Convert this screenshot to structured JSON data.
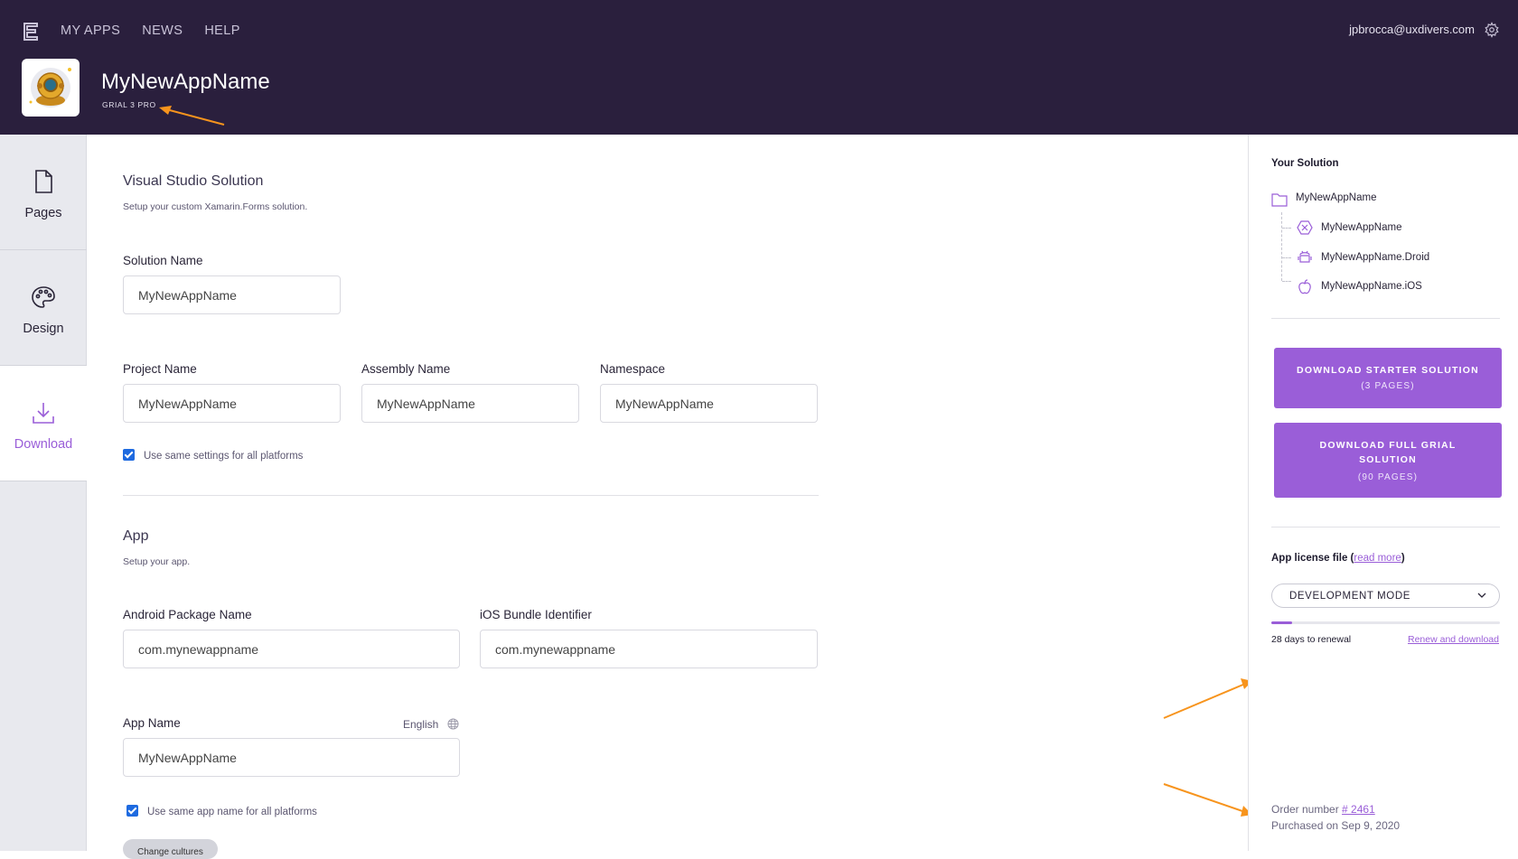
{
  "header": {
    "nav": [
      "MY APPS",
      "NEWS",
      "HELP"
    ],
    "user_email": "jpbrocca@uxdivers.com",
    "app_name": "MyNewAppName",
    "app_plan": "GRIAL 3 PRO"
  },
  "sidebar": {
    "items": [
      {
        "label": "Pages",
        "icon": "file-icon"
      },
      {
        "label": "Design",
        "icon": "palette-icon"
      },
      {
        "label": "Download",
        "icon": "download-icon",
        "active": true
      }
    ]
  },
  "vs_solution": {
    "title": "Visual Studio Solution",
    "subtitle": "Setup your custom Xamarin.Forms solution.",
    "solution_name_label": "Solution Name",
    "solution_name_value": "MyNewAppName",
    "project_name_label": "Project Name",
    "project_name_value": "MyNewAppName",
    "assembly_name_label": "Assembly Name",
    "assembly_name_value": "MyNewAppName",
    "namespace_label": "Namespace",
    "namespace_value": "MyNewAppName",
    "same_settings_label": "Use same settings for all platforms",
    "same_settings_checked": true
  },
  "app": {
    "title": "App",
    "subtitle": "Setup your app.",
    "android_label": "Android Package Name",
    "android_value": "com.mynewappname",
    "ios_label": "iOS Bundle Identifier",
    "ios_value": "com.mynewappname",
    "app_name_label": "App Name",
    "app_name_value": "MyNewAppName",
    "language": "English",
    "same_name_label": "Use same app name for all platforms",
    "same_name_checked": true,
    "change_cultures": "Change cultures"
  },
  "solution_panel": {
    "title": "Your Solution",
    "root": "MyNewAppName",
    "projects": [
      {
        "name": "MyNewAppName",
        "icon": "xamarin-icon"
      },
      {
        "name": "MyNewAppName.Droid",
        "icon": "android-icon"
      },
      {
        "name": "MyNewAppName.iOS",
        "icon": "apple-icon"
      }
    ],
    "download_starter": {
      "label": "DOWNLOAD STARTER SOLUTION",
      "sub": "(3 PAGES)"
    },
    "download_full": {
      "label": "DOWNLOAD FULL GRIAL SOLUTION",
      "sub": "(90 PAGES)"
    },
    "license_label": "App license file",
    "read_more": "read more",
    "mode": "DEVELOPMENT MODE",
    "renewal_progress": 0.09,
    "renewal_text": "28 days to renewal",
    "renew_link": "Renew and download",
    "order_label": "Order number",
    "order_number": "# 2461",
    "purchased": "Purchased on Sep 9, 2020"
  },
  "colors": {
    "header_bg": "#2a1f3d",
    "accent": "#9a5ed8",
    "annotation_arrow": "#f7941d",
    "checkbox": "#1e6ae0"
  }
}
